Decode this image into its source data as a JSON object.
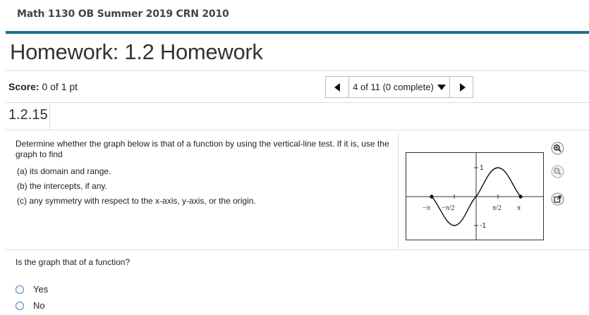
{
  "course": {
    "title": "Math 1130 OB Summer 2019 CRN 2010"
  },
  "homework": {
    "title": "Homework: 1.2 Homework"
  },
  "score": {
    "label": "Score:",
    "value": "0 of 1 pt"
  },
  "nav": {
    "progress": "4 of 11 (0 complete)"
  },
  "question": {
    "number": "1.2.15",
    "prompt": "Determine whether the graph below is that of a function by using the vertical-line test.  If it is, use the graph to find",
    "parts": [
      "(a) its domain and range.",
      "(b) the intercepts, if any.",
      "(c) any symmetry with respect to the x-axis, y-axis, or the origin."
    ],
    "followup": "Is the graph that of a function?",
    "options": [
      "Yes",
      "No"
    ]
  },
  "graph": {
    "x_ticks": [
      "−π",
      "−π/2",
      "π/2",
      "π"
    ],
    "y_ticks": [
      "1",
      "-1"
    ],
    "curve_color": "#111111"
  },
  "tools": {
    "zoom_in_icon": "zoom-in-icon",
    "zoom_out_icon": "zoom-out-icon",
    "popout_icon": "popout-icon"
  },
  "colors": {
    "accent": "#1d6f8e",
    "radio": "#4a78c2"
  }
}
